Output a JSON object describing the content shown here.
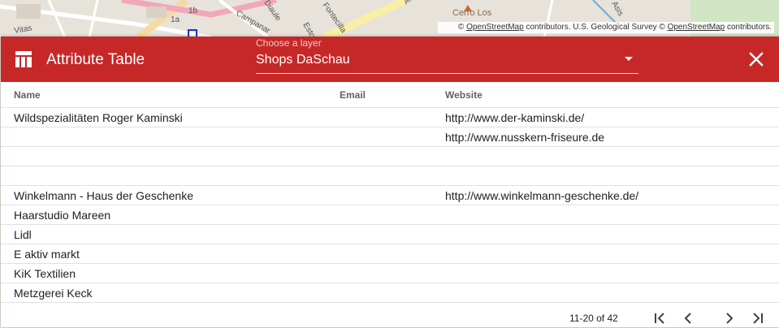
{
  "map": {
    "labels": [
      "1b",
      "1a",
      "Campanar",
      "Estor",
      "Fontecilla",
      "Ave",
      "Cerro Los",
      "Asis",
      "Vitas",
      "Diaule"
    ],
    "attribution": {
      "prefix": "©",
      "link1": "OpenStreetMap",
      "middle": "contributors. U.S. Geological Survey ©",
      "link2": "OpenStreetMap",
      "suffix": "contributors."
    }
  },
  "header": {
    "title": "Attribute Table",
    "icon": "table-icon",
    "layer_label": "Choose a layer",
    "layer_value": "Shops DaSchau",
    "close_icon": "close-icon"
  },
  "table": {
    "columns": [
      "Name",
      "Email",
      "Website"
    ],
    "rows": [
      {
        "name": "Wildspezialitäten Roger Kaminski",
        "email": "",
        "website": "http://www.der-kaminski.de/"
      },
      {
        "name": "",
        "email": "",
        "website": "http://www.nusskern-friseure.de"
      },
      {
        "name": "",
        "email": "",
        "website": ""
      },
      {
        "name": "",
        "email": "",
        "website": ""
      },
      {
        "name": "Winkelmann - Haus der Geschenke",
        "email": "",
        "website": "http://www.winkelmann-geschenke.de/"
      },
      {
        "name": "Haarstudio Mareen",
        "email": "",
        "website": ""
      },
      {
        "name": "Lidl",
        "email": "",
        "website": ""
      },
      {
        "name": "E aktiv markt",
        "email": "",
        "website": ""
      },
      {
        "name": "KiK Textilien",
        "email": "",
        "website": ""
      },
      {
        "name": "Metzgerei Keck",
        "email": "",
        "website": ""
      }
    ]
  },
  "paginator": {
    "range_label": "11-20 of 42",
    "icons": [
      "first-page-icon",
      "previous-page-icon",
      "next-page-icon",
      "last-page-icon"
    ]
  },
  "colors": {
    "header_bg": "#c62828"
  }
}
